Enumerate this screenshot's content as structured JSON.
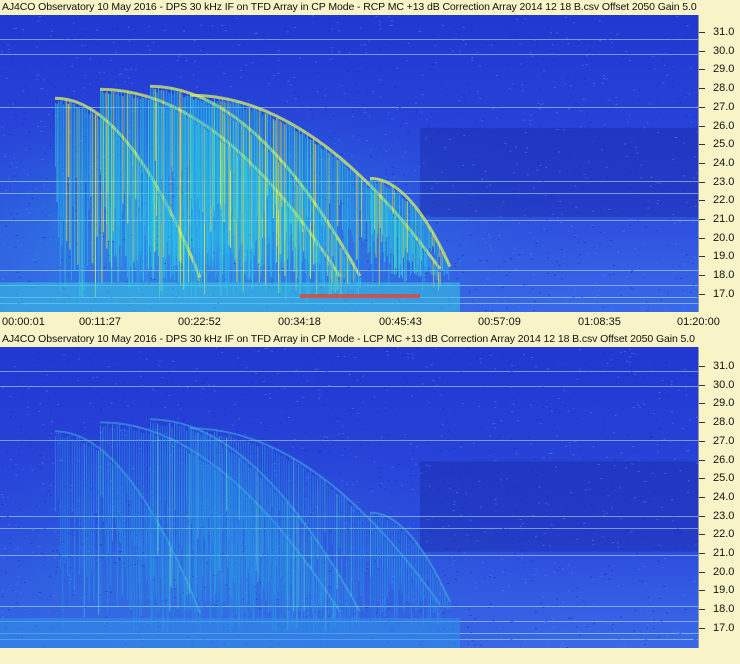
{
  "panels": [
    {
      "id": "top",
      "title": "AJ4CO Observatory 10 May 2016 - DPS 30 kHz IF on TFD Array in CP Mode - RCP  MC +13 dB  Correction Array 2014 12 18 B.csv  Offset 2050  Gain 5.0",
      "y_ticks": [
        "31.0",
        "30.0",
        "29.0",
        "28.0",
        "27.0",
        "26.0",
        "25.0",
        "24.0",
        "23.0",
        "22.0",
        "21.0",
        "20.0",
        "19.0",
        "18.0",
        "17.0"
      ],
      "x_ticks": [
        "00:00:01",
        "00:11:27",
        "00:22:52",
        "00:34:18",
        "00:45:43",
        "00:57:09",
        "01:08:35",
        "01:20:00"
      ]
    },
    {
      "id": "bottom",
      "title": "AJ4CO Observatory 10 May 2016 - DPS 30 kHz IF on TFD Array in CP Mode - LCP  MC +13 dB  Correction Array 2014 12 18 B.csv  Offset 2050  Gain 5.0",
      "y_ticks": [
        "31.0",
        "30.0",
        "29.0",
        "28.0",
        "27.0",
        "26.0",
        "25.0",
        "24.0",
        "23.0",
        "22.0",
        "21.0",
        "20.0",
        "19.0",
        "18.0",
        "17.0"
      ]
    }
  ],
  "colors": {
    "background": "#f8f4c8",
    "spectrogram_base": "#2a44d8",
    "spectrogram_low": "#1a2fb8",
    "emission_cyan": "#20c8e8",
    "emission_yellow": "#e8f040",
    "emission_red": "#e04020"
  }
}
